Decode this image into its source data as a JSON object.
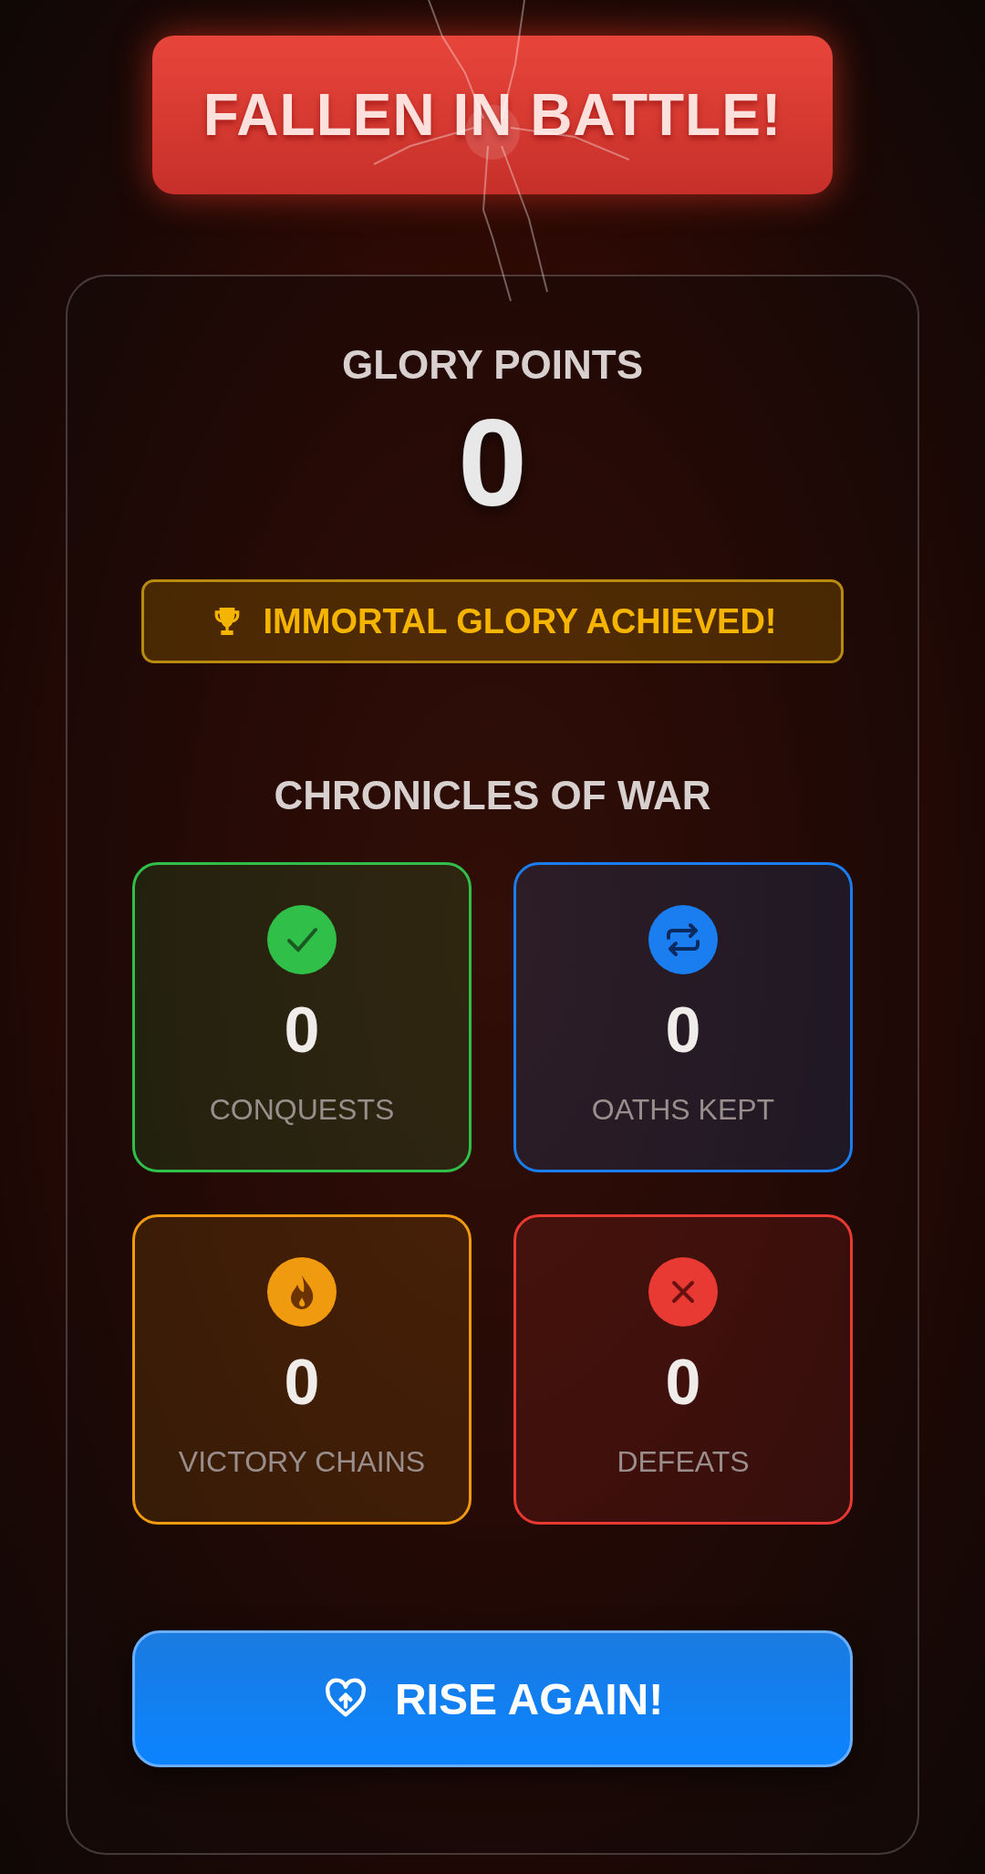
{
  "banner": {
    "title": "FALLEN IN BATTLE!"
  },
  "score": {
    "label": "GLORY POINTS",
    "value": "0"
  },
  "achievement": {
    "text": "IMMORTAL GLORY ACHIEVED!"
  },
  "stats_heading": "CHRONICLES OF WAR",
  "stats": [
    {
      "kind": "check",
      "value": "0",
      "label": "CONQUESTS",
      "color": "#30c04a"
    },
    {
      "kind": "repeat",
      "value": "0",
      "label": "OATHS KEPT",
      "color": "#1a7ef0"
    },
    {
      "kind": "flame",
      "value": "0",
      "label": "VICTORY CHAINS",
      "color": "#f09a10"
    },
    {
      "kind": "cross",
      "value": "0",
      "label": "DEFEATS",
      "color": "#e83a32"
    }
  ],
  "action_button": {
    "label": "RISE AGAIN!"
  }
}
